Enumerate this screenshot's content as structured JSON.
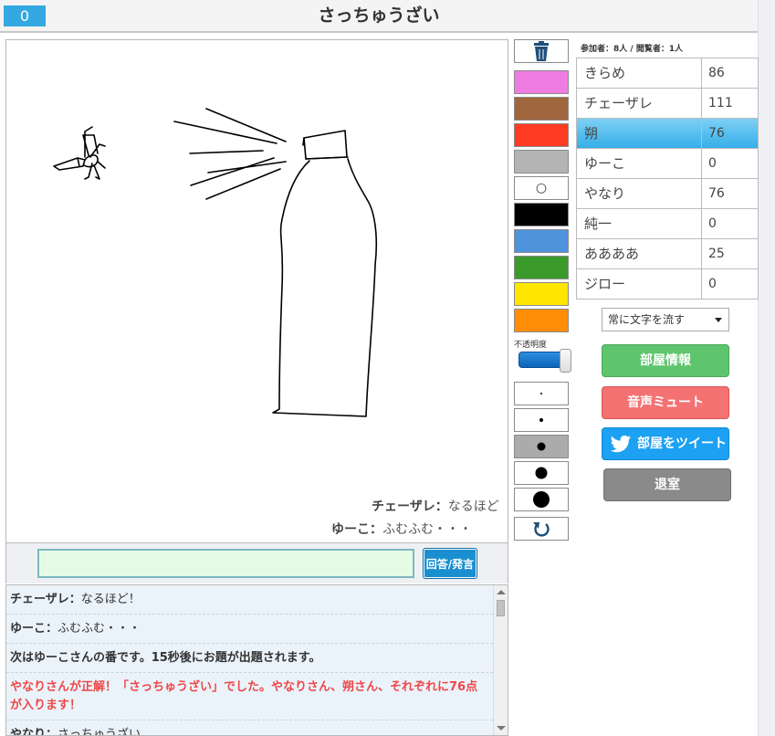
{
  "header": {
    "score": "0",
    "title": "さっちゅうざい"
  },
  "canvas": {
    "flow_messages": [
      {
        "name": "チェーザレ：",
        "text": "なるほど"
      },
      {
        "name": "ゆーこ：",
        "text": "ふむふむ・・・"
      }
    ]
  },
  "input": {
    "value": "",
    "button_label": "回答/発言"
  },
  "log": {
    "rows": [
      {
        "name": "チェーザレ：",
        "text": "なるほど！"
      },
      {
        "name": "ゆーこ：",
        "text": "ふむふむ・・・"
      },
      {
        "text": "次はゆーこさんの番です。15秒後にお題が出題されます。"
      },
      {
        "text": "やなりさんが正解！「さっちゅうざい」でした。やなりさん、朔さん、それぞれに76点が入ります！"
      },
      {
        "name": "やなり：",
        "text": "さっちゅうざい"
      }
    ]
  },
  "tools": {
    "trash_icon": "trash-icon",
    "colors": [
      "#ef7ce0",
      "#a0663e",
      "#ff3b22",
      "#b4b4b4",
      "#ffffff",
      "#000000",
      "#4f93dc",
      "#3b9b2a",
      "#ffe600",
      "#ff8e06"
    ],
    "eraser_symbol": "○",
    "opacity_label": "不透明度",
    "opacity_value": 1.0,
    "pen_sizes_selected_index": 2,
    "undo_icon": "undo-icon"
  },
  "players": {
    "summary": "参加者：8人 / 閲覧者：1人",
    "list": [
      {
        "name": "きらめ",
        "score": "86"
      },
      {
        "name": "チェーザレ",
        "score": "111"
      },
      {
        "name": "朔",
        "score": "76",
        "active": true
      },
      {
        "name": "ゆーこ",
        "score": "0"
      },
      {
        "name": "やなり",
        "score": "76"
      },
      {
        "name": "純一",
        "score": "0"
      },
      {
        "name": "ああああ",
        "score": "25"
      },
      {
        "name": "ジロー",
        "score": "0"
      }
    ]
  },
  "controls": {
    "flow_select": "常に文字を流す",
    "room_info": "部屋情報",
    "voice_mute": "音声ミュート",
    "tweet_room": "部屋をツイート",
    "exit": "退室"
  },
  "accent_colors": {
    "active_row": "#35aee8",
    "score_box": "#34a8e0"
  }
}
